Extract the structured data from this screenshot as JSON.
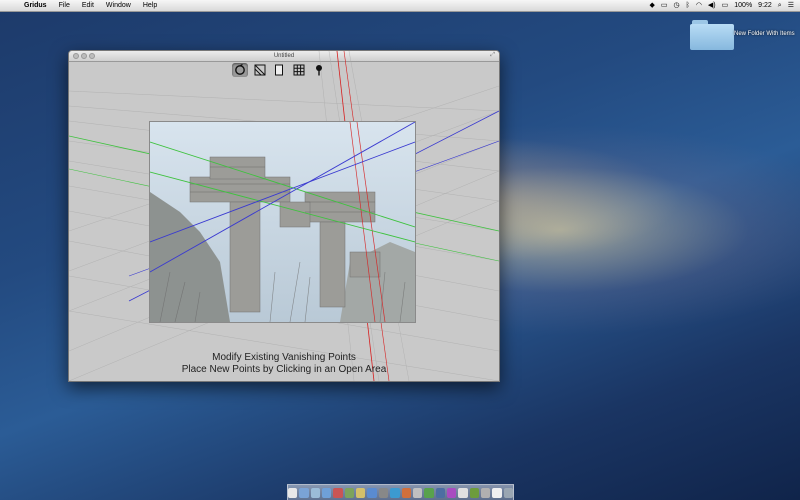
{
  "menubar": {
    "apple_glyph": "",
    "app_name": "Gridus",
    "menus": [
      "File",
      "Edit",
      "Window",
      "Help"
    ],
    "battery": "100%",
    "clock": "9:22"
  },
  "desktop": {
    "folder_label": "New Folder With Items"
  },
  "window": {
    "title": "Untitled",
    "toolbar_icons": [
      "rotate-icon",
      "vanishing-point-icon",
      "blank-page-icon",
      "grid-icon",
      "pin-icon"
    ],
    "instruction_line1": "Modify Existing Vanishing Points",
    "instruction_line2": "Place New Points by Clicking in an Open Area"
  },
  "colors": {
    "accent_green": "#3ec23e",
    "accent_blue": "#3a3ad0",
    "accent_red": "#d62020"
  },
  "dock": {
    "icon_count": 20
  }
}
